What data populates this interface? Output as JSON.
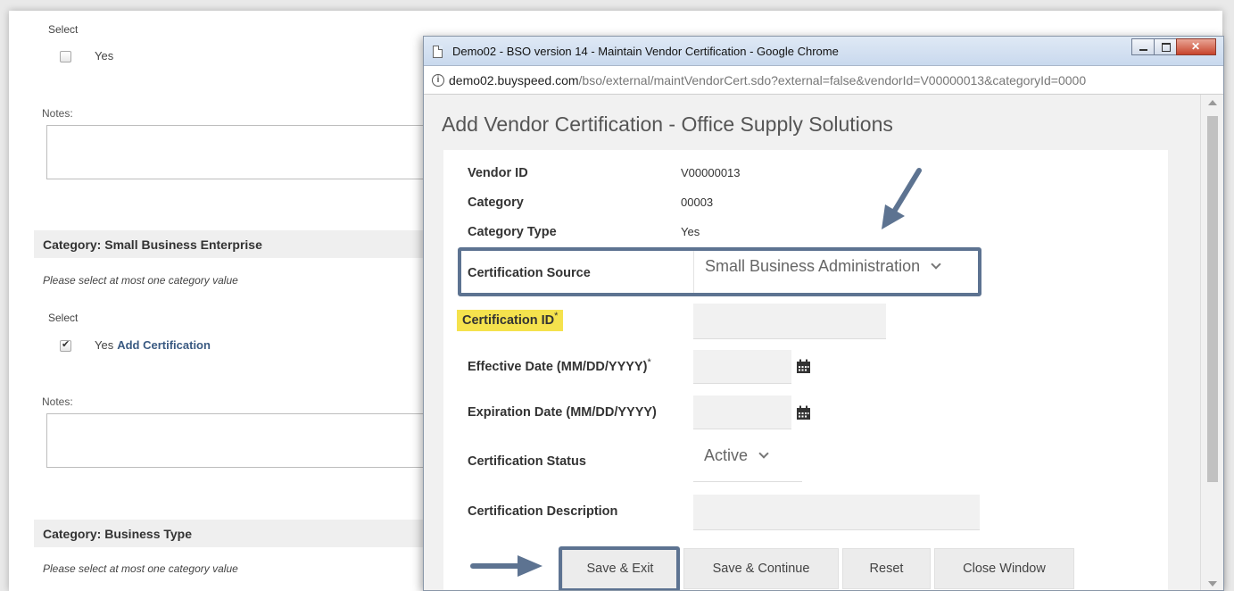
{
  "background": {
    "section1": {
      "select_label": "Select",
      "option_label": "Yes",
      "checked": false,
      "notes_label": "Notes:"
    },
    "section2": {
      "header": "Category: Small Business Enterprise",
      "hint": "Please select at most one category value",
      "select_label": "Select",
      "option_label": "Yes",
      "link_label": "Add Certification",
      "checked": true,
      "notes_label": "Notes:"
    },
    "section3": {
      "header": "Category: Business Type",
      "hint": "Please select at most one category value"
    }
  },
  "window": {
    "title": "Demo02 - BSO version 14 - Maintain Vendor Certification - Google Chrome",
    "url_host": "demo02.buyspeed.com",
    "url_path": "/bso/external/maintVendorCert.sdo?external=false&vendorId=V00000013&categoryId=0000"
  },
  "page": {
    "heading": "Add Vendor Certification  -  Office Supply Solutions"
  },
  "form": {
    "vendor_id": {
      "label": "Vendor ID",
      "value": "V00000013"
    },
    "category": {
      "label": "Category",
      "value": "00003"
    },
    "category_type": {
      "label": "Category Type",
      "value": "Yes"
    },
    "certification_source": {
      "label": "Certification Source",
      "value": "Small Business Administration"
    },
    "certification_id": {
      "label": "Certification ID",
      "required": "*",
      "value": ""
    },
    "effective_date": {
      "label": "Effective Date (MM/DD/YYYY)",
      "required": "*",
      "value": ""
    },
    "expiration_date": {
      "label": "Expiration Date (MM/DD/YYYY)",
      "value": ""
    },
    "certification_status": {
      "label": "Certification Status",
      "value": "Active"
    },
    "certification_description": {
      "label": "Certification Description",
      "value": ""
    }
  },
  "buttons": {
    "save_exit": "Save & Exit",
    "save_continue": "Save & Continue",
    "reset": "Reset",
    "close_window": "Close Window"
  },
  "colors": {
    "accent_box": "#5d7391",
    "highlight": "#f5e24d"
  }
}
